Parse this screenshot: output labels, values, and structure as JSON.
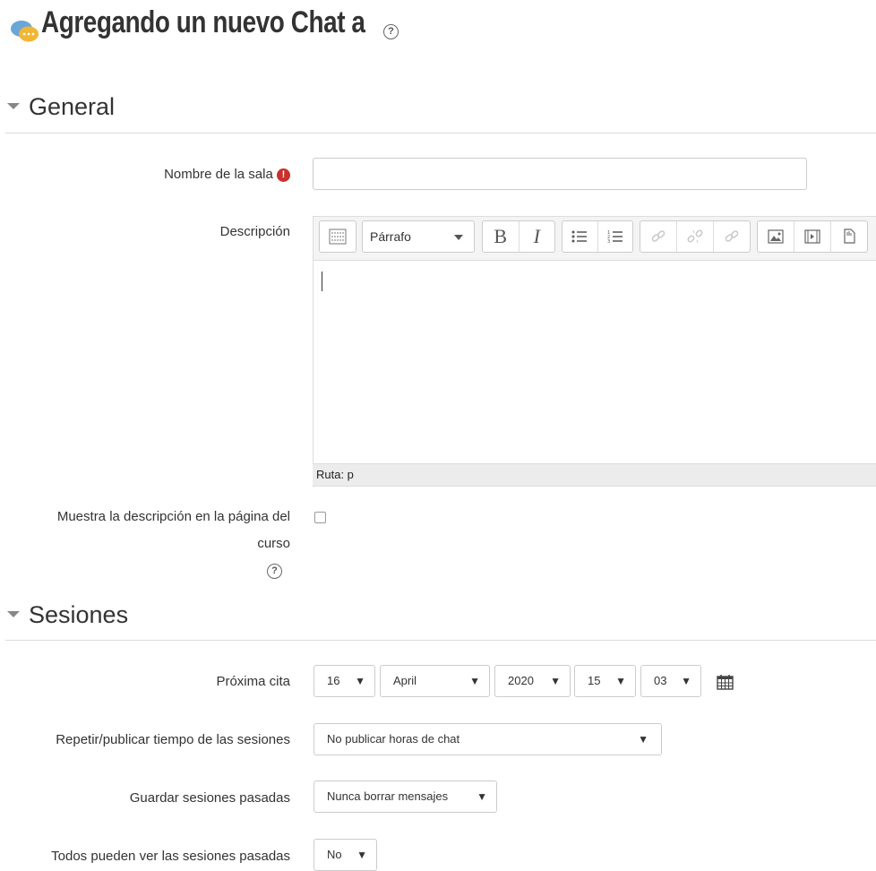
{
  "header": {
    "title": "Agregando un nuevo Chat a",
    "help_glyph": "?"
  },
  "sections": {
    "general": "General",
    "sesiones": "Sesiones"
  },
  "form": {
    "nombre_label": "Nombre de la sala",
    "required_glyph": "!",
    "nombre_value": "",
    "descripcion_label": "Descripción",
    "format_select": "Párrafo",
    "bold_glyph": "B",
    "italic_glyph": "I",
    "path_text": "Ruta: p",
    "show_desc_label_line1": "Muestra la descripción en la página del",
    "show_desc_label_line2": "curso",
    "show_desc_checked": false,
    "proxima_cita_label": "Próxima cita",
    "date": {
      "day": "16",
      "month": "April",
      "year": "2020",
      "hour": "15",
      "minute": "03"
    },
    "repetir_label": "Repetir/publicar tiempo de las sesiones",
    "repetir_value": "No publicar horas de chat",
    "guardar_label": "Guardar sesiones pasadas",
    "guardar_value": "Nunca borrar mensajes",
    "todos_label": "Todos pueden ver las sesiones pasadas",
    "todos_value": "No"
  },
  "icons": {
    "chat": "chat-bubbles-icon",
    "help": "question-circle-icon",
    "calendar": "calendar-icon",
    "dropdown_arrow": "▼"
  },
  "colors": {
    "required": "#c9302c",
    "chat_icon_blue": "#6aa6d8",
    "chat_icon_yellow": "#f2b632"
  }
}
